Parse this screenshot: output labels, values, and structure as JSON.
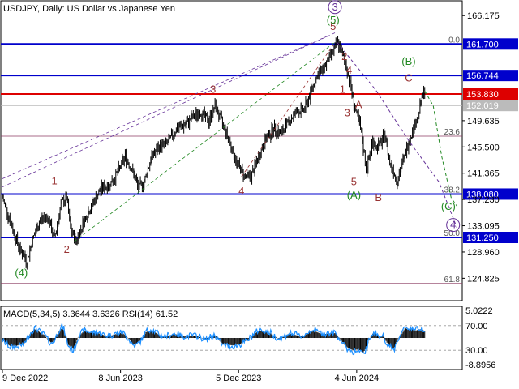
{
  "chart_data": {
    "type": "line",
    "title": "USDJPY, Daily:  US Dollar vs Japanese Yen",
    "price_scale": {
      "min": 121.3,
      "max": 168.5,
      "ticks": [
        "166.175",
        "161.700",
        "156.744",
        "153.830",
        "152.019",
        "149.635",
        "145.500",
        "141.365",
        "138.080",
        "137.230",
        "133.095",
        "131.250",
        "128.960",
        "124.825"
      ],
      "tick_values": [
        166.175,
        161.7,
        156.744,
        153.83,
        152.019,
        149.635,
        145.5,
        141.365,
        138.08,
        137.23,
        133.095,
        131.25,
        128.96,
        124.825
      ]
    },
    "x_labels": [
      {
        "date": "9 Dec 2022",
        "index": 0
      },
      {
        "date": "8 Jun 2023",
        "index": 125
      },
      {
        "date": "5 Dec 2023",
        "index": 250
      },
      {
        "date": "4 Jun 2024",
        "index": 375
      }
    ],
    "bars_count": 485,
    "price_path": [
      [
        0,
        137.5
      ],
      [
        10,
        133.0
      ],
      [
        18,
        129.5
      ],
      [
        26,
        127.5
      ],
      [
        32,
        131.0
      ],
      [
        40,
        134.0
      ],
      [
        48,
        134.5
      ],
      [
        55,
        131.0
      ],
      [
        62,
        136.5
      ],
      [
        68,
        137.5
      ],
      [
        72,
        132.5
      ],
      [
        78,
        130.6
      ],
      [
        85,
        133.5
      ],
      [
        95,
        136.5
      ],
      [
        105,
        139.0
      ],
      [
        113,
        139.5
      ],
      [
        122,
        141.5
      ],
      [
        130,
        144.0
      ],
      [
        137,
        142.0
      ],
      [
        144,
        139.0
      ],
      [
        150,
        140.0
      ],
      [
        158,
        144.0
      ],
      [
        166,
        145.5
      ],
      [
        175,
        146.2
      ],
      [
        185,
        148.5
      ],
      [
        193,
        149.0
      ],
      [
        200,
        150.0
      ],
      [
        210,
        151.0
      ],
      [
        218,
        149.5
      ],
      [
        225,
        151.9
      ],
      [
        232,
        149.5
      ],
      [
        240,
        146.5
      ],
      [
        248,
        143.0
      ],
      [
        256,
        141.0
      ],
      [
        263,
        140.8
      ],
      [
        270,
        143.5
      ],
      [
        278,
        146.5
      ],
      [
        287,
        148.5
      ],
      [
        295,
        147.5
      ],
      [
        303,
        149.5
      ],
      [
        311,
        151.0
      ],
      [
        320,
        151.5
      ],
      [
        326,
        154.0
      ],
      [
        332,
        156.5
      ],
      [
        338,
        157.5
      ],
      [
        344,
        159.0
      ],
      [
        350,
        160.5
      ],
      [
        355,
        161.95
      ],
      [
        360,
        160.0
      ],
      [
        365,
        157.5
      ],
      [
        370,
        154.0
      ],
      [
        374,
        151.0
      ],
      [
        378,
        149.0
      ],
      [
        381,
        146.5
      ],
      [
        385,
        142.0
      ],
      [
        388,
        143.5
      ],
      [
        392,
        146.5
      ],
      [
        396,
        145.5
      ],
      [
        400,
        146.0
      ],
      [
        405,
        147.5
      ],
      [
        410,
        143.0
      ],
      [
        414,
        141.8
      ],
      [
        418,
        140.0
      ],
      [
        422,
        142.5
      ],
      [
        426,
        144.0
      ],
      [
        430,
        146.5
      ],
      [
        435,
        148.5
      ],
      [
        440,
        150.5
      ],
      [
        444,
        153.0
      ],
      [
        447,
        154.3
      ]
    ],
    "projection": {
      "green_path": [
        [
          447,
          154.3
        ],
        [
          456,
          152.0
        ],
        [
          465,
          144.0
        ],
        [
          475,
          137.5
        ],
        [
          481,
          136.2
        ]
      ],
      "purple_path": [
        [
          354,
          162.0
        ],
        [
          395,
          154.5
        ],
        [
          430,
          146.5
        ],
        [
          462,
          140.0
        ],
        [
          474,
          135.5
        ],
        [
          481,
          132.8
        ]
      ]
    },
    "horizontal_levels": [
      {
        "value": 161.7,
        "label": "161.700",
        "color": "#0000cc"
      },
      {
        "value": 156.744,
        "label": "156.744",
        "color": "#0000cc"
      },
      {
        "value": 153.83,
        "label": "153.830",
        "color": "#dd0000"
      },
      {
        "value": 138.08,
        "label": "138.080",
        "color": "#0000cc"
      },
      {
        "value": 131.25,
        "label": "131.250",
        "color": "#0000cc"
      },
      {
        "value": 152.019,
        "label": "152.019",
        "color": "#bbbbbb"
      }
    ],
    "fibonacci": [
      {
        "value": 161.7,
        "label": "0.0"
      },
      {
        "value": 147.2,
        "label": "23.6"
      },
      {
        "value": 138.1,
        "label": "38.2"
      },
      {
        "value": 131.25,
        "label": "50.0"
      },
      {
        "value": 124.0,
        "label": "61.8"
      }
    ],
    "wave_labels": [
      {
        "text": "(4)",
        "index": 20,
        "value": 125.1,
        "color": "#228822"
      },
      {
        "text": "1",
        "index": 55,
        "value": 139.6,
        "color": "#993333"
      },
      {
        "text": "2",
        "index": 68,
        "value": 128.8,
        "color": "#993333"
      },
      {
        "text": "3",
        "index": 223,
        "value": 154.0,
        "color": "#993333"
      },
      {
        "text": "4",
        "index": 253,
        "value": 138.0,
        "color": "#993333"
      },
      {
        "text": "5",
        "index": 350,
        "value": 163.9,
        "color": "#993333"
      },
      {
        "text": "(5)",
        "index": 350,
        "value": 164.9,
        "color": "#228822"
      },
      {
        "text": "3",
        "index": 352,
        "value": 167.0,
        "color": "#663399"
      },
      {
        "text": "2",
        "index": 362,
        "value": 159.2,
        "color": "#993333"
      },
      {
        "text": "4",
        "index": 367,
        "value": 157.0,
        "color": "#993333"
      },
      {
        "text": "1",
        "index": 360,
        "value": 154.0,
        "color": "#993333"
      },
      {
        "text": "A",
        "index": 377,
        "value": 151.6,
        "color": "#993333"
      },
      {
        "text": "3",
        "index": 365,
        "value": 150.3,
        "color": "#993333"
      },
      {
        "text": "5",
        "index": 372,
        "value": 139.5,
        "color": "#993333"
      },
      {
        "text": "(A)",
        "index": 372,
        "value": 137.4,
        "color": "#228822"
      },
      {
        "text": "B",
        "index": 398,
        "value": 137.0,
        "color": "#993333"
      },
      {
        "text": "C",
        "index": 430,
        "value": 155.8,
        "color": "#993333"
      },
      {
        "text": "(B)",
        "index": 430,
        "value": 158.4,
        "color": "#228822"
      },
      {
        "text": "(C)",
        "index": 472,
        "value": 135.6,
        "color": "#228822"
      },
      {
        "text": "4",
        "index": 477,
        "value": 132.7,
        "color": "#663399"
      }
    ],
    "indicator_panel": {
      "label": "MACD(5,34,5) 3.3644 3.6326 RSI(14) 61.52",
      "ticks": [
        "5.0222",
        "70.00",
        "30.00",
        "-8.8956"
      ]
    }
  }
}
